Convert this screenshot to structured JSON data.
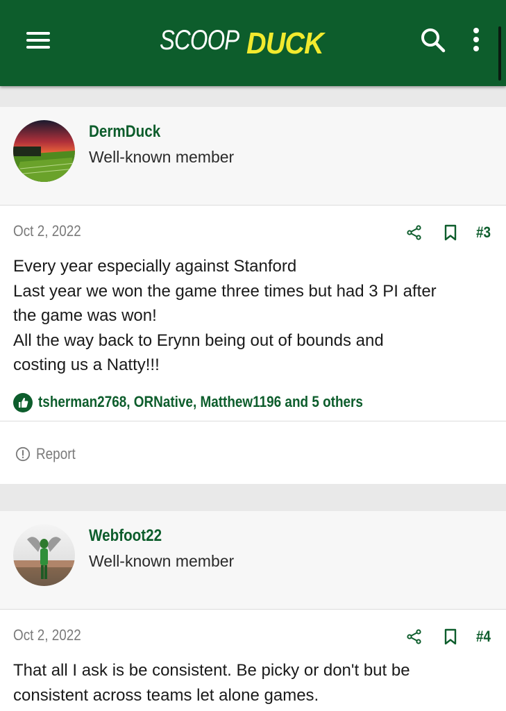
{
  "header": {
    "logo_part1": "SCOOP",
    "logo_part2": "DUCK",
    "brand_color": "#0d5d2c",
    "logo_accent_color": "#f2ea2e",
    "icons": [
      "menu-icon",
      "search-icon",
      "more-vertical-icon"
    ]
  },
  "posts": [
    {
      "username": "DermDuck",
      "user_title": "Well-known member",
      "date": "Oct 2, 2022",
      "post_number": "#3",
      "body_lines": [
        "Every year especially against Stanford",
        "Last year we won the game three times but had 3 PI after",
        "the game was won!",
        "All the way back to Erynn being out of bounds and",
        "costing us a Natty!!!"
      ],
      "reactions": "tsherman2768, ORNative, Matthew1196 and 5 others",
      "report_label": "Report"
    },
    {
      "username": "Webfoot22",
      "user_title": "Well-known member",
      "date": "Oct 2, 2022",
      "post_number": "#4",
      "body_lines": [
        "That all I ask is be consistent. Be picky or don't but be",
        "consistent across teams let alone games."
      ]
    }
  ]
}
